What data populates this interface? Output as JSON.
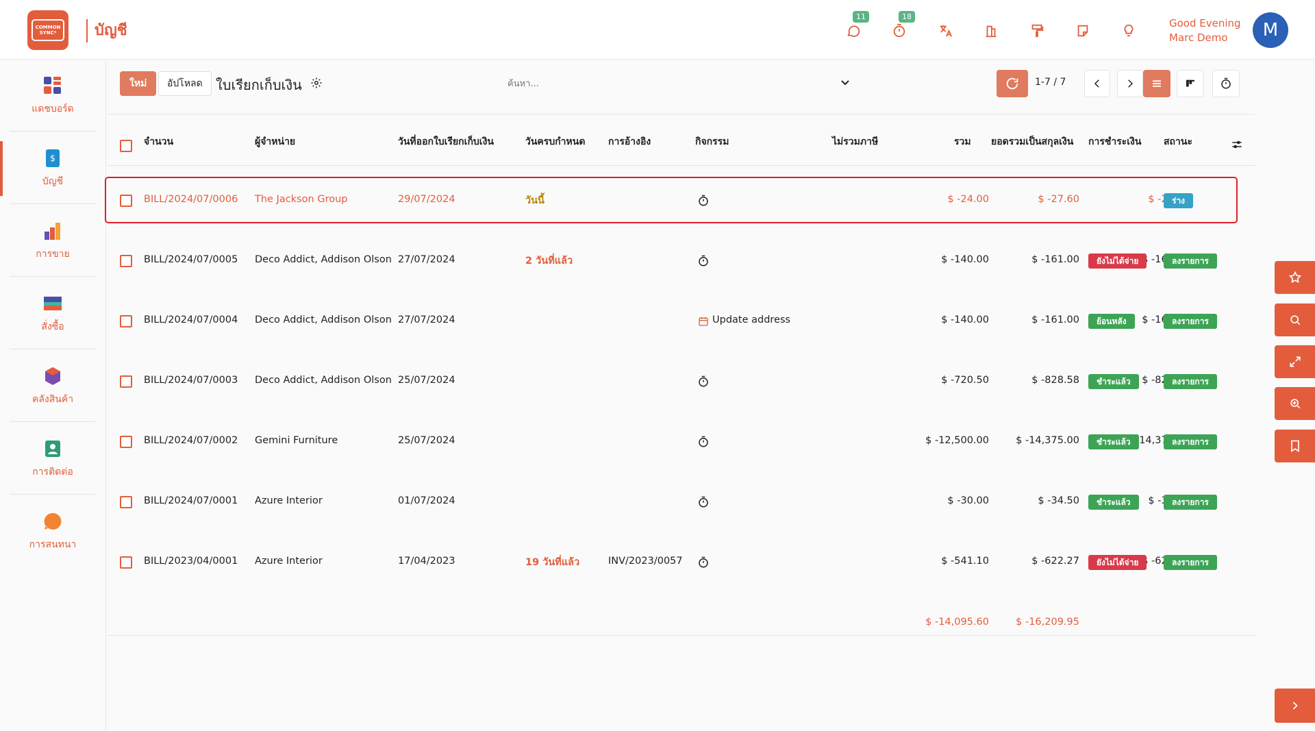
{
  "header": {
    "logo_text_1": "COMMON",
    "logo_text_2": "SYNC*",
    "app_title": "บัญชี",
    "badges": {
      "chat": "11",
      "timer": "18"
    },
    "greeting_line1": "Good Evening",
    "greeting_line2": "Marc Demo",
    "avatar_letter": "M"
  },
  "sidebar": {
    "items": [
      {
        "label": "แดชบอร์ด",
        "icon": "dashboard-icon"
      },
      {
        "label": "บัญชี",
        "icon": "invoice-icon"
      },
      {
        "label": "การขาย",
        "icon": "sales-icon"
      },
      {
        "label": "สั่งซื้อ",
        "icon": "purchase-icon"
      },
      {
        "label": "คลังสินค้า",
        "icon": "inventory-icon"
      },
      {
        "label": "การติดต่อ",
        "icon": "contacts-icon"
      },
      {
        "label": "การสนทนา",
        "icon": "discuss-icon"
      }
    ]
  },
  "control": {
    "new_label": "ใหม่",
    "upload_label": "อัปโหลด",
    "title": "ใบเรียกเก็บเงิน",
    "search_placeholder": "ค้นหา...",
    "pager": "1-7 / 7"
  },
  "table": {
    "headers": {
      "number": "จำนวน",
      "vendor": "ผู้จำหน่าย",
      "bill_date": "วันที่ออกใบเรียกเก็บเงิน",
      "due_date": "วันครบกำหนด",
      "reference": "การอ้างอิง",
      "activity": "กิจกรรม",
      "untaxed": "ไม่รวมภาษี",
      "total": "รวม",
      "total_currency": "ยอดรวมเป็นสกุลเงิน",
      "payment": "การชำระเงิน",
      "status": "สถานะ"
    },
    "rows": [
      {
        "number": "BILL/2024/07/0006",
        "vendor": "The Jackson Group",
        "bill_date": "29/07/2024",
        "due_date": "วันนี้",
        "reference": "",
        "activity": "",
        "untaxed": "$ -24.00",
        "total": "$ -27.60",
        "total_currency": "$ -27.60",
        "payment": "",
        "status": "ร่าง"
      },
      {
        "number": "BILL/2024/07/0005",
        "vendor": "Deco Addict, Addison Olson",
        "bill_date": "27/07/2024",
        "due_date": "2 วันที่แล้ว",
        "reference": "",
        "activity": "",
        "untaxed": "$ -140.00",
        "total": "$ -161.00",
        "total_currency": "$ -161.00",
        "payment": "ยังไม่ได้จ่าย",
        "status": "ลงรายการ"
      },
      {
        "number": "BILL/2024/07/0004",
        "vendor": "Deco Addict, Addison Olson",
        "bill_date": "27/07/2024",
        "due_date": "",
        "reference": "",
        "activity": "Update address",
        "untaxed": "$ -140.00",
        "total": "$ -161.00",
        "total_currency": "$ -161.00",
        "payment": "ย้อนหลัง",
        "status": "ลงรายการ"
      },
      {
        "number": "BILL/2024/07/0003",
        "vendor": "Deco Addict, Addison Olson",
        "bill_date": "25/07/2024",
        "due_date": "",
        "reference": "",
        "activity": "",
        "untaxed": "$ -720.50",
        "total": "$ -828.58",
        "total_currency": "$ -828.58",
        "payment": "ชำระแล้ว",
        "status": "ลงรายการ"
      },
      {
        "number": "BILL/2024/07/0002",
        "vendor": "Gemini Furniture",
        "bill_date": "25/07/2024",
        "due_date": "",
        "reference": "",
        "activity": "",
        "untaxed": "$ -12,500.00",
        "total": "$ -14,375.00",
        "total_currency": "$ -14,375.00",
        "payment": "ชำระแล้ว",
        "status": "ลงรายการ"
      },
      {
        "number": "BILL/2024/07/0001",
        "vendor": "Azure Interior",
        "bill_date": "01/07/2024",
        "due_date": "",
        "reference": "",
        "activity": "",
        "untaxed": "$ -30.00",
        "total": "$ -34.50",
        "total_currency": "$ -34.50",
        "payment": "ชำระแล้ว",
        "status": "ลงรายการ"
      },
      {
        "number": "BILL/2023/04/0001",
        "vendor": "Azure Interior",
        "bill_date": "17/04/2023",
        "due_date": "19 วันที่แล้ว",
        "reference": "INV/2023/0057",
        "activity": "",
        "untaxed": "$ -541.10",
        "total": "$ -622.27",
        "total_currency": "$ -622.27",
        "payment": "ยังไม่ได้จ่าย",
        "status": "ลงรายการ"
      }
    ],
    "totals": {
      "untaxed": "$ -14,095.60",
      "total": "$ -16,209.95"
    }
  },
  "colors": {
    "accent": "#e35d3c",
    "paid": "#3da456",
    "unpaid": "#d93a4a",
    "draft": "#36a2c6",
    "highlight": "#e02026"
  }
}
